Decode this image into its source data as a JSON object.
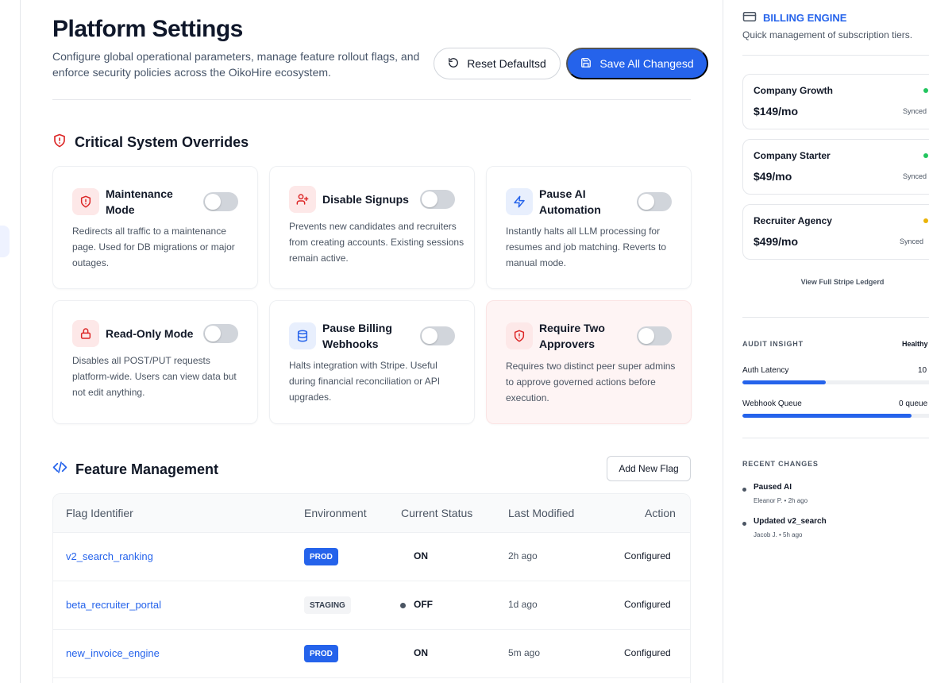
{
  "header": {
    "title": "Platform Settings",
    "subtitle": "Configure global operational parameters, manage feature rollout flags, and enforce security policies across the OikoHire ecosystem.",
    "reset_label": "Reset Defaultsd",
    "save_label": "Save All Changesd"
  },
  "overrides": {
    "title": "Critical System Overrides",
    "cards": [
      {
        "title": "Maintenance Mode",
        "desc": "Redirects all traffic to a maintenance page. Used for DB migrations or major outages.",
        "icon": "alert-shield-icon",
        "enabled": false
      },
      {
        "title": "Disable Signups",
        "desc": "Prevents new candidates and recruiters from creating accounts. Existing sessions remain active.",
        "icon": "user-plus-icon",
        "enabled": false
      },
      {
        "title": "Pause AI Automation",
        "desc": "Instantly halts all LLM processing for resumes and job matching. Reverts to manual mode.",
        "icon": "lightning-icon",
        "enabled": false
      },
      {
        "title": "Read-Only Mode",
        "desc": "Disables all POST/PUT requests platform-wide. Users can view data but not edit anything.",
        "icon": "lock-icon",
        "enabled": false
      },
      {
        "title": "Pause Billing Webhooks",
        "desc": "Halts integration with Stripe. Useful during financial reconciliation or API upgrades.",
        "icon": "database-icon",
        "enabled": false
      },
      {
        "title": "Require Two Approvers",
        "desc": "Requires two distinct peer super admins to approve governed actions before execution.",
        "icon": "alert-shield-icon",
        "enabled": false
      }
    ]
  },
  "features": {
    "title": "Feature Management",
    "add_label": "Add New Flag",
    "columns": [
      "Flag Identifier",
      "Environment",
      "Current Status",
      "Last Modified",
      "Action"
    ],
    "rows": [
      {
        "flag": "v2_search_ranking",
        "env": "PROD",
        "status": "ON",
        "modified": "2h ago",
        "action": "Configured"
      },
      {
        "flag": "beta_recruiter_portal",
        "env": "STAGING",
        "status": "OFF",
        "modified": "1d ago",
        "action": "Configured"
      },
      {
        "flag": "new_invoice_engine",
        "env": "PROD",
        "status": "ON",
        "modified": "5m ago",
        "action": "Configured"
      }
    ]
  },
  "billing": {
    "title": "BILLING ENGINE",
    "subtitle": "Quick management of subscription tiers.",
    "tiers": [
      {
        "name": "Company Growth",
        "price": "$149/mo",
        "status": "Synced",
        "dot_color": "#22c55e"
      },
      {
        "name": "Company Starter",
        "price": "$49/mo",
        "status": "Synced",
        "dot_color": "#22c55e"
      },
      {
        "name": "Recruiter Agency",
        "price": "$499/mo",
        "status": "Synced",
        "dot_color": "#eab308"
      }
    ],
    "ledger_label": "View Full Stripe Ledgerd"
  },
  "audit": {
    "title": "AUDIT INSIGHT",
    "health": "Healthy",
    "metrics": [
      {
        "label": "Auth Latency",
        "value": "10",
        "fill": 0.42
      },
      {
        "label": "Webhook Queue",
        "value": "0 queue",
        "fill": 0.85
      }
    ]
  },
  "recent": {
    "title": "RECENT CHANGES",
    "items": [
      {
        "title": "Paused AI",
        "meta": "Eleanor P. • 2h ago"
      },
      {
        "title": "Updated v2_search",
        "meta": "Jacob J. • 5h ago"
      }
    ]
  },
  "colors": {
    "accent": "#2563eb",
    "danger": "#dc2626"
  }
}
